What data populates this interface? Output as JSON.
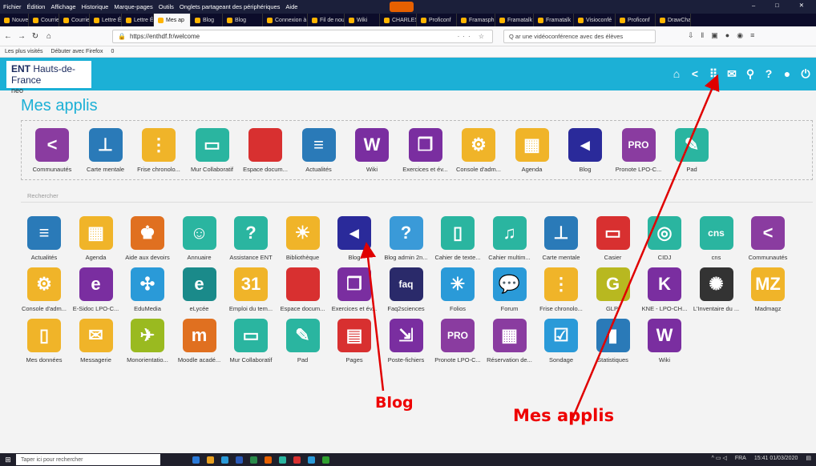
{
  "browser": {
    "menu": [
      "Fichier",
      "Édition",
      "Affichage",
      "Historique",
      "Marque-pages",
      "Outils",
      "Onglets partageant des périphériques",
      "Aide"
    ],
    "tabs": [
      {
        "label": "Nouvel on",
        "active": false
      },
      {
        "label": "Courrier",
        "active": false
      },
      {
        "label": "Courrier",
        "active": false
      },
      {
        "label": "Lettre Édu",
        "active": false
      },
      {
        "label": "Lettre Édu",
        "active": false
      },
      {
        "label": "Mes ap",
        "active": true
      },
      {
        "label": "Blog",
        "active": false
      },
      {
        "label": "Blog",
        "active": false
      },
      {
        "label": "Connexion à l'",
        "active": false
      },
      {
        "label": "Fil de nou",
        "active": false
      },
      {
        "label": "Wiki",
        "active": false
      },
      {
        "label": "CHARLES",
        "active": false
      },
      {
        "label": "Proficonf",
        "active": false
      },
      {
        "label": "Framasph",
        "active": false
      },
      {
        "label": "Framatalk",
        "active": false
      },
      {
        "label": "Framatalk",
        "active": false
      },
      {
        "label": "Visioconfé",
        "active": false
      },
      {
        "label": "Proficonf",
        "active": false
      },
      {
        "label": "DrawChat",
        "active": false
      }
    ],
    "url": "https://enthdf.fr/welcome",
    "search_value": "Q ar une vidéoconférence avec des élèves",
    "bookmarks": [
      "Les plus visités",
      "Débuter avec Firefox",
      "0"
    ]
  },
  "header": {
    "logo_main": "ENT",
    "logo_region": "Hauts-de-France",
    "logo_sub": "neo",
    "icons": [
      "home-icon",
      "share-icon",
      "apps-grid-icon",
      "mail-icon",
      "search-icon",
      "help-icon",
      "user-icon",
      "power-icon"
    ]
  },
  "page": {
    "title": "Mes applis",
    "separator_label": "Rechercher"
  },
  "favorites": [
    {
      "label": "Communautés",
      "icon": "share-icon",
      "color": "#8a3ca0",
      "glyph": "<"
    },
    {
      "label": "Carte mentale",
      "icon": "sitemap-icon",
      "color": "#2a7ab8",
      "glyph": "⊥"
    },
    {
      "label": "Frise chronolo...",
      "icon": "timeline-icon",
      "color": "#f0b429",
      "glyph": "⋮"
    },
    {
      "label": "Mur Collaboratif",
      "icon": "board-icon",
      "color": "#2ab5a0",
      "glyph": "▭"
    },
    {
      "label": "Espace docum...",
      "icon": "folder-icon",
      "color": "#d83030",
      "glyph": " "
    },
    {
      "label": "Actualités",
      "icon": "news-icon",
      "color": "#2a7ab8",
      "glyph": "≡"
    },
    {
      "label": "Wiki",
      "icon": "wiki-icon",
      "color": "#7a2ea0",
      "glyph": "W"
    },
    {
      "label": "Exercices et év...",
      "icon": "cubes-icon",
      "color": "#7a2ea0",
      "glyph": "❒"
    },
    {
      "label": "Console d'adm...",
      "icon": "gears-icon",
      "color": "#f0b429",
      "glyph": "⚙"
    },
    {
      "label": "Agenda",
      "icon": "calendar-icon",
      "color": "#f0b429",
      "glyph": "▦"
    },
    {
      "label": "Blog",
      "icon": "megaphone-icon",
      "color": "#2a2a9a",
      "glyph": "◂"
    },
    {
      "label": "Pronote LPO-C...",
      "icon": "pronote-icon",
      "color": "#8a3ca0",
      "glyph": "PRO"
    },
    {
      "label": "Pad",
      "icon": "pad-icon",
      "color": "#2ab5a0",
      "glyph": "✎"
    }
  ],
  "apps": [
    {
      "label": "Actualités",
      "icon": "news-icon",
      "color": "#2a7ab8",
      "glyph": "≡"
    },
    {
      "label": "Agenda",
      "icon": "calendar-icon",
      "color": "#f0b429",
      "glyph": "▦"
    },
    {
      "label": "Aide aux devoirs",
      "icon": "trophy-icon",
      "color": "#e07020",
      "glyph": "♚"
    },
    {
      "label": "Annuaire",
      "icon": "contacts-icon",
      "color": "#2ab5a0",
      "glyph": "☺"
    },
    {
      "label": "Assistance ENT",
      "icon": "help-icon",
      "color": "#2ab5a0",
      "glyph": "?"
    },
    {
      "label": "Bibliothèque",
      "icon": "bulb-icon",
      "color": "#f0b429",
      "glyph": "☀"
    },
    {
      "label": "Blog",
      "icon": "megaphone-icon",
      "color": "#2a2a9a",
      "glyph": "◂"
    },
    {
      "label": "Blog admin 2n...",
      "icon": "person-help-icon",
      "color": "#3a9ad8",
      "glyph": "?"
    },
    {
      "label": "Cahier de texte...",
      "icon": "notebook-icon",
      "color": "#2ab5a0",
      "glyph": "▯"
    },
    {
      "label": "Cahier multim...",
      "icon": "multimedia-icon",
      "color": "#2ab5a0",
      "glyph": "♫"
    },
    {
      "label": "Carte mentale",
      "icon": "sitemap-icon",
      "color": "#2a7ab8",
      "glyph": "⊥"
    },
    {
      "label": "Casier",
      "icon": "inbox-icon",
      "color": "#d83030",
      "glyph": "▭"
    },
    {
      "label": "CIDJ",
      "icon": "aperture-icon",
      "color": "#2ab5a0",
      "glyph": "◎"
    },
    {
      "label": "cns",
      "icon": "cns-icon",
      "color": "#2ab5a0",
      "glyph": "cns"
    },
    {
      "label": "Communautés",
      "icon": "share-icon",
      "color": "#8a3ca0",
      "glyph": "<"
    },
    {
      "label": "Console d'adm...",
      "icon": "gears-icon",
      "color": "#f0b429",
      "glyph": "⚙"
    },
    {
      "label": "E-Sidoc LPO-C...",
      "icon": "esidoc-icon",
      "color": "#7a2ea0",
      "glyph": "e"
    },
    {
      "label": "EduMedia",
      "icon": "edumedia-icon",
      "color": "#2a9ad8",
      "glyph": "✣"
    },
    {
      "label": "eLycée",
      "icon": "elycee-icon",
      "color": "#1a8a8a",
      "glyph": "e"
    },
    {
      "label": "Emploi du tem...",
      "icon": "calendar-31-icon",
      "color": "#f0b429",
      "glyph": "31"
    },
    {
      "label": "Espace docum...",
      "icon": "folder-icon",
      "color": "#d83030",
      "glyph": " "
    },
    {
      "label": "Exercices et év...",
      "icon": "cubes-icon",
      "color": "#7a2ea0",
      "glyph": "❒"
    },
    {
      "label": "Faq2sciences",
      "icon": "faq-icon",
      "color": "#2a2a6a",
      "glyph": "faq"
    },
    {
      "label": "Folios",
      "icon": "onisep-icon",
      "color": "#2a9ad8",
      "glyph": "✳"
    },
    {
      "label": "Forum",
      "icon": "chat-icon",
      "color": "#2a9ad8",
      "glyph": "💬"
    },
    {
      "label": "Frise chronolo...",
      "icon": "timeline-icon",
      "color": "#f0b429",
      "glyph": "⋮"
    },
    {
      "label": "GLPI",
      "icon": "glpi-icon",
      "color": "#b8b820",
      "glyph": "G"
    },
    {
      "label": "KNE - LPO-CH...",
      "icon": "kne-icon",
      "color": "#7a2ea0",
      "glyph": "K"
    },
    {
      "label": "L'Inventaire du ...",
      "icon": "inventaire-icon",
      "color": "#333333",
      "glyph": "✺"
    },
    {
      "label": "Madmagz",
      "icon": "madmagz-icon",
      "color": "#f0b429",
      "glyph": "MZ"
    },
    {
      "label": "Mes données",
      "icon": "zip-icon",
      "color": "#f0b429",
      "glyph": "▯"
    },
    {
      "label": "Messagerie",
      "icon": "envelope-icon",
      "color": "#f0b429",
      "glyph": "✉"
    },
    {
      "label": "Monorientatio...",
      "icon": "monorientation-icon",
      "color": "#9aba20",
      "glyph": "✈"
    },
    {
      "label": "Moodle acadé...",
      "icon": "moodle-icon",
      "color": "#e07020",
      "glyph": "m"
    },
    {
      "label": "Mur Collaboratif",
      "icon": "board-icon",
      "color": "#2ab5a0",
      "glyph": "▭"
    },
    {
      "label": "Pad",
      "icon": "pad-icon",
      "color": "#2ab5a0",
      "glyph": "✎"
    },
    {
      "label": "Pages",
      "icon": "pages-icon",
      "color": "#d83030",
      "glyph": "▤"
    },
    {
      "label": "Poste-fichiers",
      "icon": "cart-icon",
      "color": "#7a2ea0",
      "glyph": "⇲"
    },
    {
      "label": "Pronote LPO-C...",
      "icon": "pronote-icon",
      "color": "#8a3ca0",
      "glyph": "PRO"
    },
    {
      "label": "Réservation de...",
      "icon": "reservation-icon",
      "color": "#8a3ca0",
      "glyph": "▦"
    },
    {
      "label": "Sondage",
      "icon": "checkbox-icon",
      "color": "#2a9ad8",
      "glyph": "☑"
    },
    {
      "label": "Statistiques",
      "icon": "stats-icon",
      "color": "#2a7ab8",
      "glyph": "▮"
    },
    {
      "label": "Wiki",
      "icon": "wiki-icon",
      "color": "#7a2ea0",
      "glyph": "W"
    }
  ],
  "annotations": {
    "blog": "Blog",
    "mes_applis": "Mes applis",
    "color": "#e00000"
  },
  "taskbar": {
    "search_placeholder": "Taper ici pour rechercher",
    "language": "FRA",
    "time": "15:41",
    "date": "01/03/2020"
  }
}
